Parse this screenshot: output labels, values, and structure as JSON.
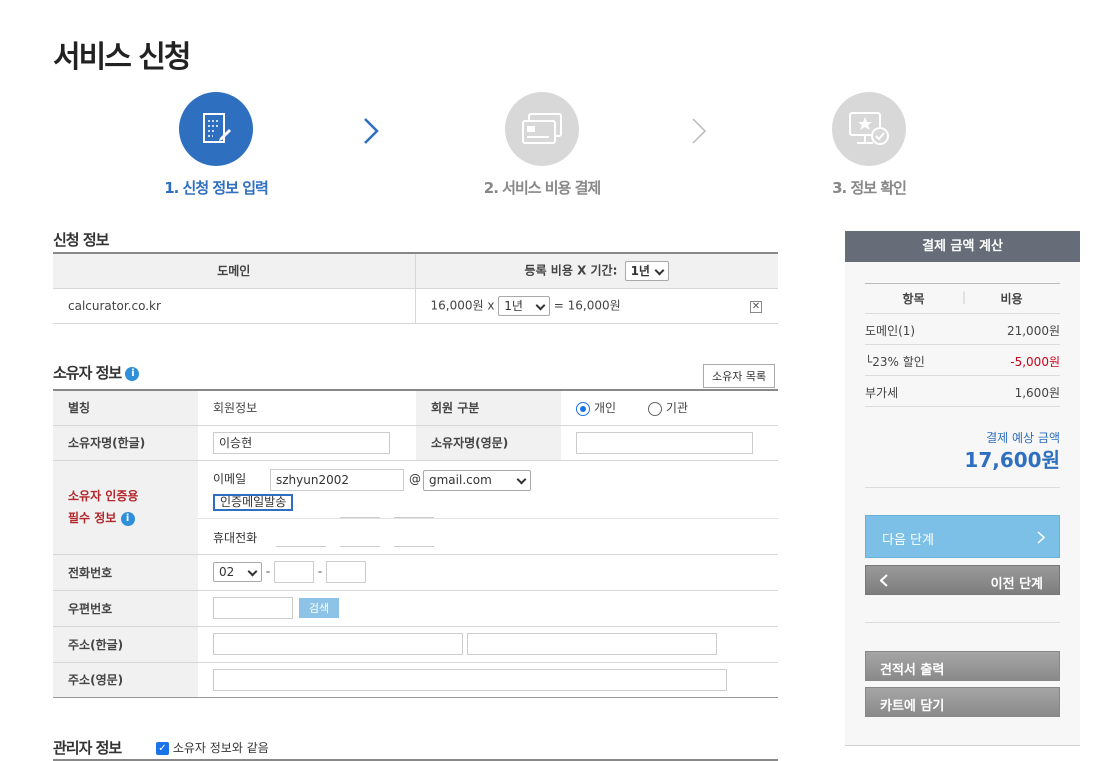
{
  "page": {
    "title": "서비스 신청"
  },
  "steps": [
    {
      "label": "1. 신청 정보 입력",
      "state": "active",
      "icon": "document-edit-icon"
    },
    {
      "label": "2. 서비스 비용 결제",
      "state": "inactive",
      "icon": "credit-card-icon"
    },
    {
      "label": "3. 정보 확인",
      "state": "inactive",
      "icon": "monitor-star-check-icon"
    }
  ],
  "application": {
    "title": "신청 정보",
    "col_domain": "도메인",
    "col_cost": "등록 비용 X 기간:",
    "period_select": "1년",
    "domain": "calcurator.co.kr",
    "unit_price": "16,000원 x",
    "row_period": "1년",
    "row_total": "= 16,000원"
  },
  "owner": {
    "title": "소유자 정보",
    "list_button": "소유자 목록",
    "alias_label": "별칭",
    "alias_value": "회원정보",
    "member_type_label": "회원 구분",
    "member_type_options": [
      "개인",
      "기관"
    ],
    "member_type_selected": "개인",
    "name_ko_label": "소유자명(한글)",
    "name_ko_value": "이승현",
    "name_en_label": "소유자명(영문)",
    "name_en_value": "",
    "auth_label_1": "소유자 인증용",
    "auth_label_2": "필수 정보",
    "email_label": "이메일",
    "email_user": "szhyun2002",
    "email_at": "@",
    "email_domain": "gmail.com",
    "send_mail_button": "인증메일발송",
    "mobile_label": "휴대전화",
    "phone_label": "전화번호",
    "phone_prefix": "02",
    "dash": "-",
    "zip_label": "우편번호",
    "zip_search_button": "검색",
    "addr_ko_label": "주소(한글)",
    "addr_en_label": "주소(영문)"
  },
  "admin": {
    "title": "관리자 정보",
    "same_as_owner_label": "소유자 정보와 같음",
    "same_as_owner_checked": true
  },
  "summary": {
    "title": "결제 금액 계산",
    "col_item": "항목",
    "col_cost": "비용",
    "rows": [
      {
        "label": "도메인(1)",
        "value": "21,000원",
        "color": "#444444"
      },
      {
        "label": "└23% 할인",
        "value": "-5,000원",
        "color": "#d0021b"
      },
      {
        "label": "부가세",
        "value": "1,600원",
        "color": "#444444"
      }
    ],
    "expected_label": "결제 예상 금액",
    "expected_value": "17,600원",
    "next_button": "다음 단계",
    "prev_button": "이전 단계",
    "quote_button": "견적서 출력",
    "cart_button": "카트에 담기"
  },
  "colors": {
    "accent": "#2f6fc0",
    "next_button": "#7cc0e8",
    "gray_button": "#8a8a8a",
    "discount": "#d0021b"
  }
}
